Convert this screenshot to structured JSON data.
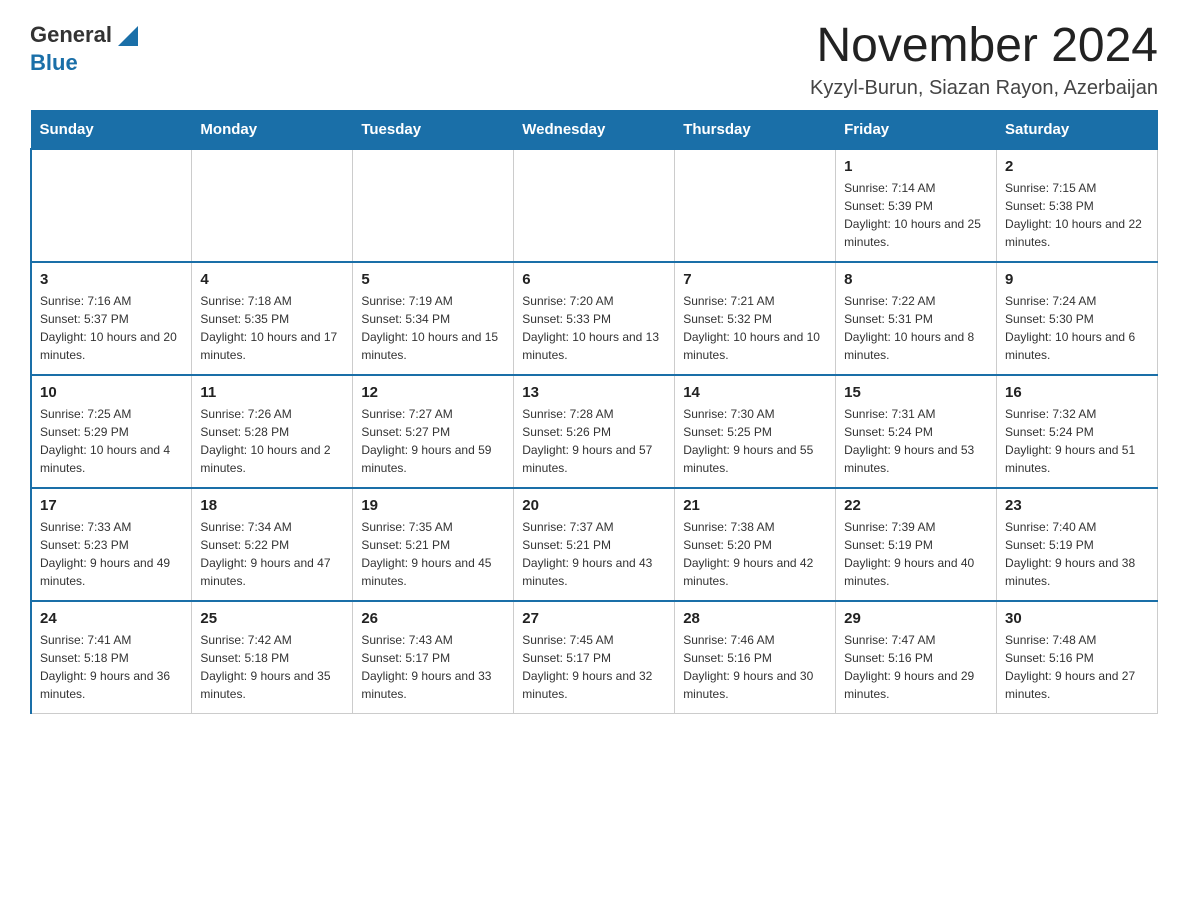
{
  "header": {
    "logo_general": "General",
    "logo_blue": "Blue",
    "month_title": "November 2024",
    "location": "Kyzyl-Burun, Siazan Rayon, Azerbaijan"
  },
  "days_of_week": [
    "Sunday",
    "Monday",
    "Tuesday",
    "Wednesday",
    "Thursday",
    "Friday",
    "Saturday"
  ],
  "weeks": [
    [
      {
        "day": "",
        "info": ""
      },
      {
        "day": "",
        "info": ""
      },
      {
        "day": "",
        "info": ""
      },
      {
        "day": "",
        "info": ""
      },
      {
        "day": "",
        "info": ""
      },
      {
        "day": "1",
        "info": "Sunrise: 7:14 AM\nSunset: 5:39 PM\nDaylight: 10 hours and 25 minutes."
      },
      {
        "day": "2",
        "info": "Sunrise: 7:15 AM\nSunset: 5:38 PM\nDaylight: 10 hours and 22 minutes."
      }
    ],
    [
      {
        "day": "3",
        "info": "Sunrise: 7:16 AM\nSunset: 5:37 PM\nDaylight: 10 hours and 20 minutes."
      },
      {
        "day": "4",
        "info": "Sunrise: 7:18 AM\nSunset: 5:35 PM\nDaylight: 10 hours and 17 minutes."
      },
      {
        "day": "5",
        "info": "Sunrise: 7:19 AM\nSunset: 5:34 PM\nDaylight: 10 hours and 15 minutes."
      },
      {
        "day": "6",
        "info": "Sunrise: 7:20 AM\nSunset: 5:33 PM\nDaylight: 10 hours and 13 minutes."
      },
      {
        "day": "7",
        "info": "Sunrise: 7:21 AM\nSunset: 5:32 PM\nDaylight: 10 hours and 10 minutes."
      },
      {
        "day": "8",
        "info": "Sunrise: 7:22 AM\nSunset: 5:31 PM\nDaylight: 10 hours and 8 minutes."
      },
      {
        "day": "9",
        "info": "Sunrise: 7:24 AM\nSunset: 5:30 PM\nDaylight: 10 hours and 6 minutes."
      }
    ],
    [
      {
        "day": "10",
        "info": "Sunrise: 7:25 AM\nSunset: 5:29 PM\nDaylight: 10 hours and 4 minutes."
      },
      {
        "day": "11",
        "info": "Sunrise: 7:26 AM\nSunset: 5:28 PM\nDaylight: 10 hours and 2 minutes."
      },
      {
        "day": "12",
        "info": "Sunrise: 7:27 AM\nSunset: 5:27 PM\nDaylight: 9 hours and 59 minutes."
      },
      {
        "day": "13",
        "info": "Sunrise: 7:28 AM\nSunset: 5:26 PM\nDaylight: 9 hours and 57 minutes."
      },
      {
        "day": "14",
        "info": "Sunrise: 7:30 AM\nSunset: 5:25 PM\nDaylight: 9 hours and 55 minutes."
      },
      {
        "day": "15",
        "info": "Sunrise: 7:31 AM\nSunset: 5:24 PM\nDaylight: 9 hours and 53 minutes."
      },
      {
        "day": "16",
        "info": "Sunrise: 7:32 AM\nSunset: 5:24 PM\nDaylight: 9 hours and 51 minutes."
      }
    ],
    [
      {
        "day": "17",
        "info": "Sunrise: 7:33 AM\nSunset: 5:23 PM\nDaylight: 9 hours and 49 minutes."
      },
      {
        "day": "18",
        "info": "Sunrise: 7:34 AM\nSunset: 5:22 PM\nDaylight: 9 hours and 47 minutes."
      },
      {
        "day": "19",
        "info": "Sunrise: 7:35 AM\nSunset: 5:21 PM\nDaylight: 9 hours and 45 minutes."
      },
      {
        "day": "20",
        "info": "Sunrise: 7:37 AM\nSunset: 5:21 PM\nDaylight: 9 hours and 43 minutes."
      },
      {
        "day": "21",
        "info": "Sunrise: 7:38 AM\nSunset: 5:20 PM\nDaylight: 9 hours and 42 minutes."
      },
      {
        "day": "22",
        "info": "Sunrise: 7:39 AM\nSunset: 5:19 PM\nDaylight: 9 hours and 40 minutes."
      },
      {
        "day": "23",
        "info": "Sunrise: 7:40 AM\nSunset: 5:19 PM\nDaylight: 9 hours and 38 minutes."
      }
    ],
    [
      {
        "day": "24",
        "info": "Sunrise: 7:41 AM\nSunset: 5:18 PM\nDaylight: 9 hours and 36 minutes."
      },
      {
        "day": "25",
        "info": "Sunrise: 7:42 AM\nSunset: 5:18 PM\nDaylight: 9 hours and 35 minutes."
      },
      {
        "day": "26",
        "info": "Sunrise: 7:43 AM\nSunset: 5:17 PM\nDaylight: 9 hours and 33 minutes."
      },
      {
        "day": "27",
        "info": "Sunrise: 7:45 AM\nSunset: 5:17 PM\nDaylight: 9 hours and 32 minutes."
      },
      {
        "day": "28",
        "info": "Sunrise: 7:46 AM\nSunset: 5:16 PM\nDaylight: 9 hours and 30 minutes."
      },
      {
        "day": "29",
        "info": "Sunrise: 7:47 AM\nSunset: 5:16 PM\nDaylight: 9 hours and 29 minutes."
      },
      {
        "day": "30",
        "info": "Sunrise: 7:48 AM\nSunset: 5:16 PM\nDaylight: 9 hours and 27 minutes."
      }
    ]
  ]
}
